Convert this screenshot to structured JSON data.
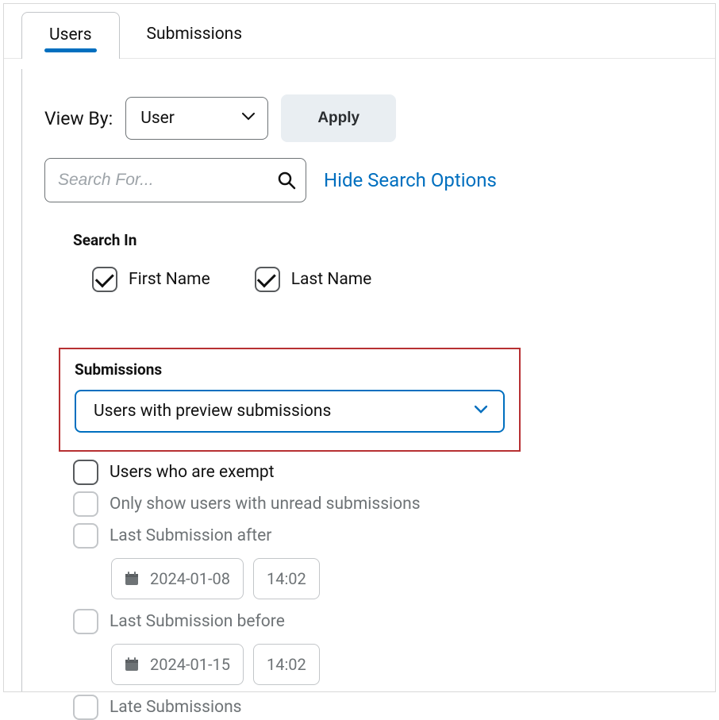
{
  "tabs": {
    "users": "Users",
    "submissions": "Submissions"
  },
  "viewBy": {
    "label": "View By:",
    "selected": "User",
    "applyLabel": "Apply"
  },
  "search": {
    "placeholder": "Search For...",
    "hideOptionsLabel": "Hide Search Options"
  },
  "searchIn": {
    "label": "Search In",
    "firstName": "First Name",
    "lastName": "Last Name"
  },
  "submissions": {
    "label": "Submissions",
    "selected": "Users with preview submissions"
  },
  "filters": {
    "exempt": "Users who are exempt",
    "unread": "Only show users with unread submissions",
    "afterLabel": "Last Submission after",
    "afterDate": "2024-01-08",
    "afterTime": "14:02",
    "beforeLabel": "Last Submission before",
    "beforeDate": "2024-01-15",
    "beforeTime": "14:02",
    "late": "Late Submissions"
  }
}
